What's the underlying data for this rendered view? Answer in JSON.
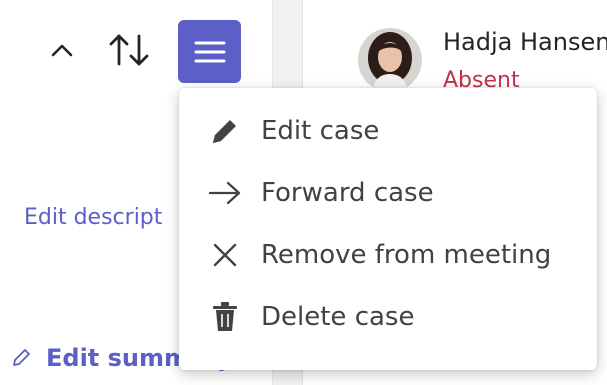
{
  "left": {
    "edit_description_label": "Edit descript",
    "edit_summary_label": "Edit summary"
  },
  "person": {
    "name": "Hadja Hansen",
    "status": "Absent"
  },
  "menu": {
    "items": [
      {
        "label": "Edit case",
        "icon": "pencil-icon"
      },
      {
        "label": "Forward case",
        "icon": "arrow-right-icon"
      },
      {
        "label": "Remove from meeting",
        "icon": "close-icon"
      },
      {
        "label": "Delete case",
        "icon": "trash-icon"
      }
    ]
  },
  "colors": {
    "accent": "#5b5fc7",
    "absent": "#c4314b",
    "text": "#424242"
  }
}
